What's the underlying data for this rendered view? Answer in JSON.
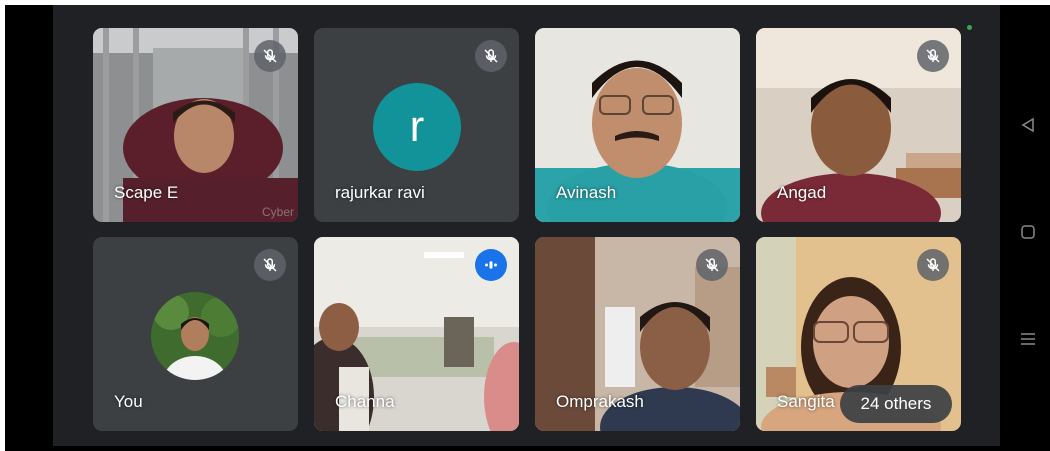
{
  "participants": [
    {
      "name": "Scape E",
      "muted": true,
      "watermark": "Cyber"
    },
    {
      "name": "rajurkar ravi",
      "muted": true,
      "initial": "r"
    },
    {
      "name": "Avinash",
      "muted": false
    },
    {
      "name": "Angad",
      "muted": true
    },
    {
      "name": "You",
      "muted": true
    },
    {
      "name": "Channa",
      "muted": false,
      "speaking": true
    },
    {
      "name": "Omprakash",
      "muted": true
    },
    {
      "name": "Sangita",
      "muted": true
    }
  ],
  "overflow": {
    "label": "24 others"
  },
  "colors": {
    "stage_bg": "#202124",
    "tile_bg": "#3c4043",
    "avatar_r": "#12939a",
    "speaking": "#1a73e8",
    "status_dot": "#34a853"
  },
  "icons": [
    "mic-off-icon",
    "speaking-indicator-icon",
    "back-icon",
    "home-icon",
    "recents-icon"
  ]
}
